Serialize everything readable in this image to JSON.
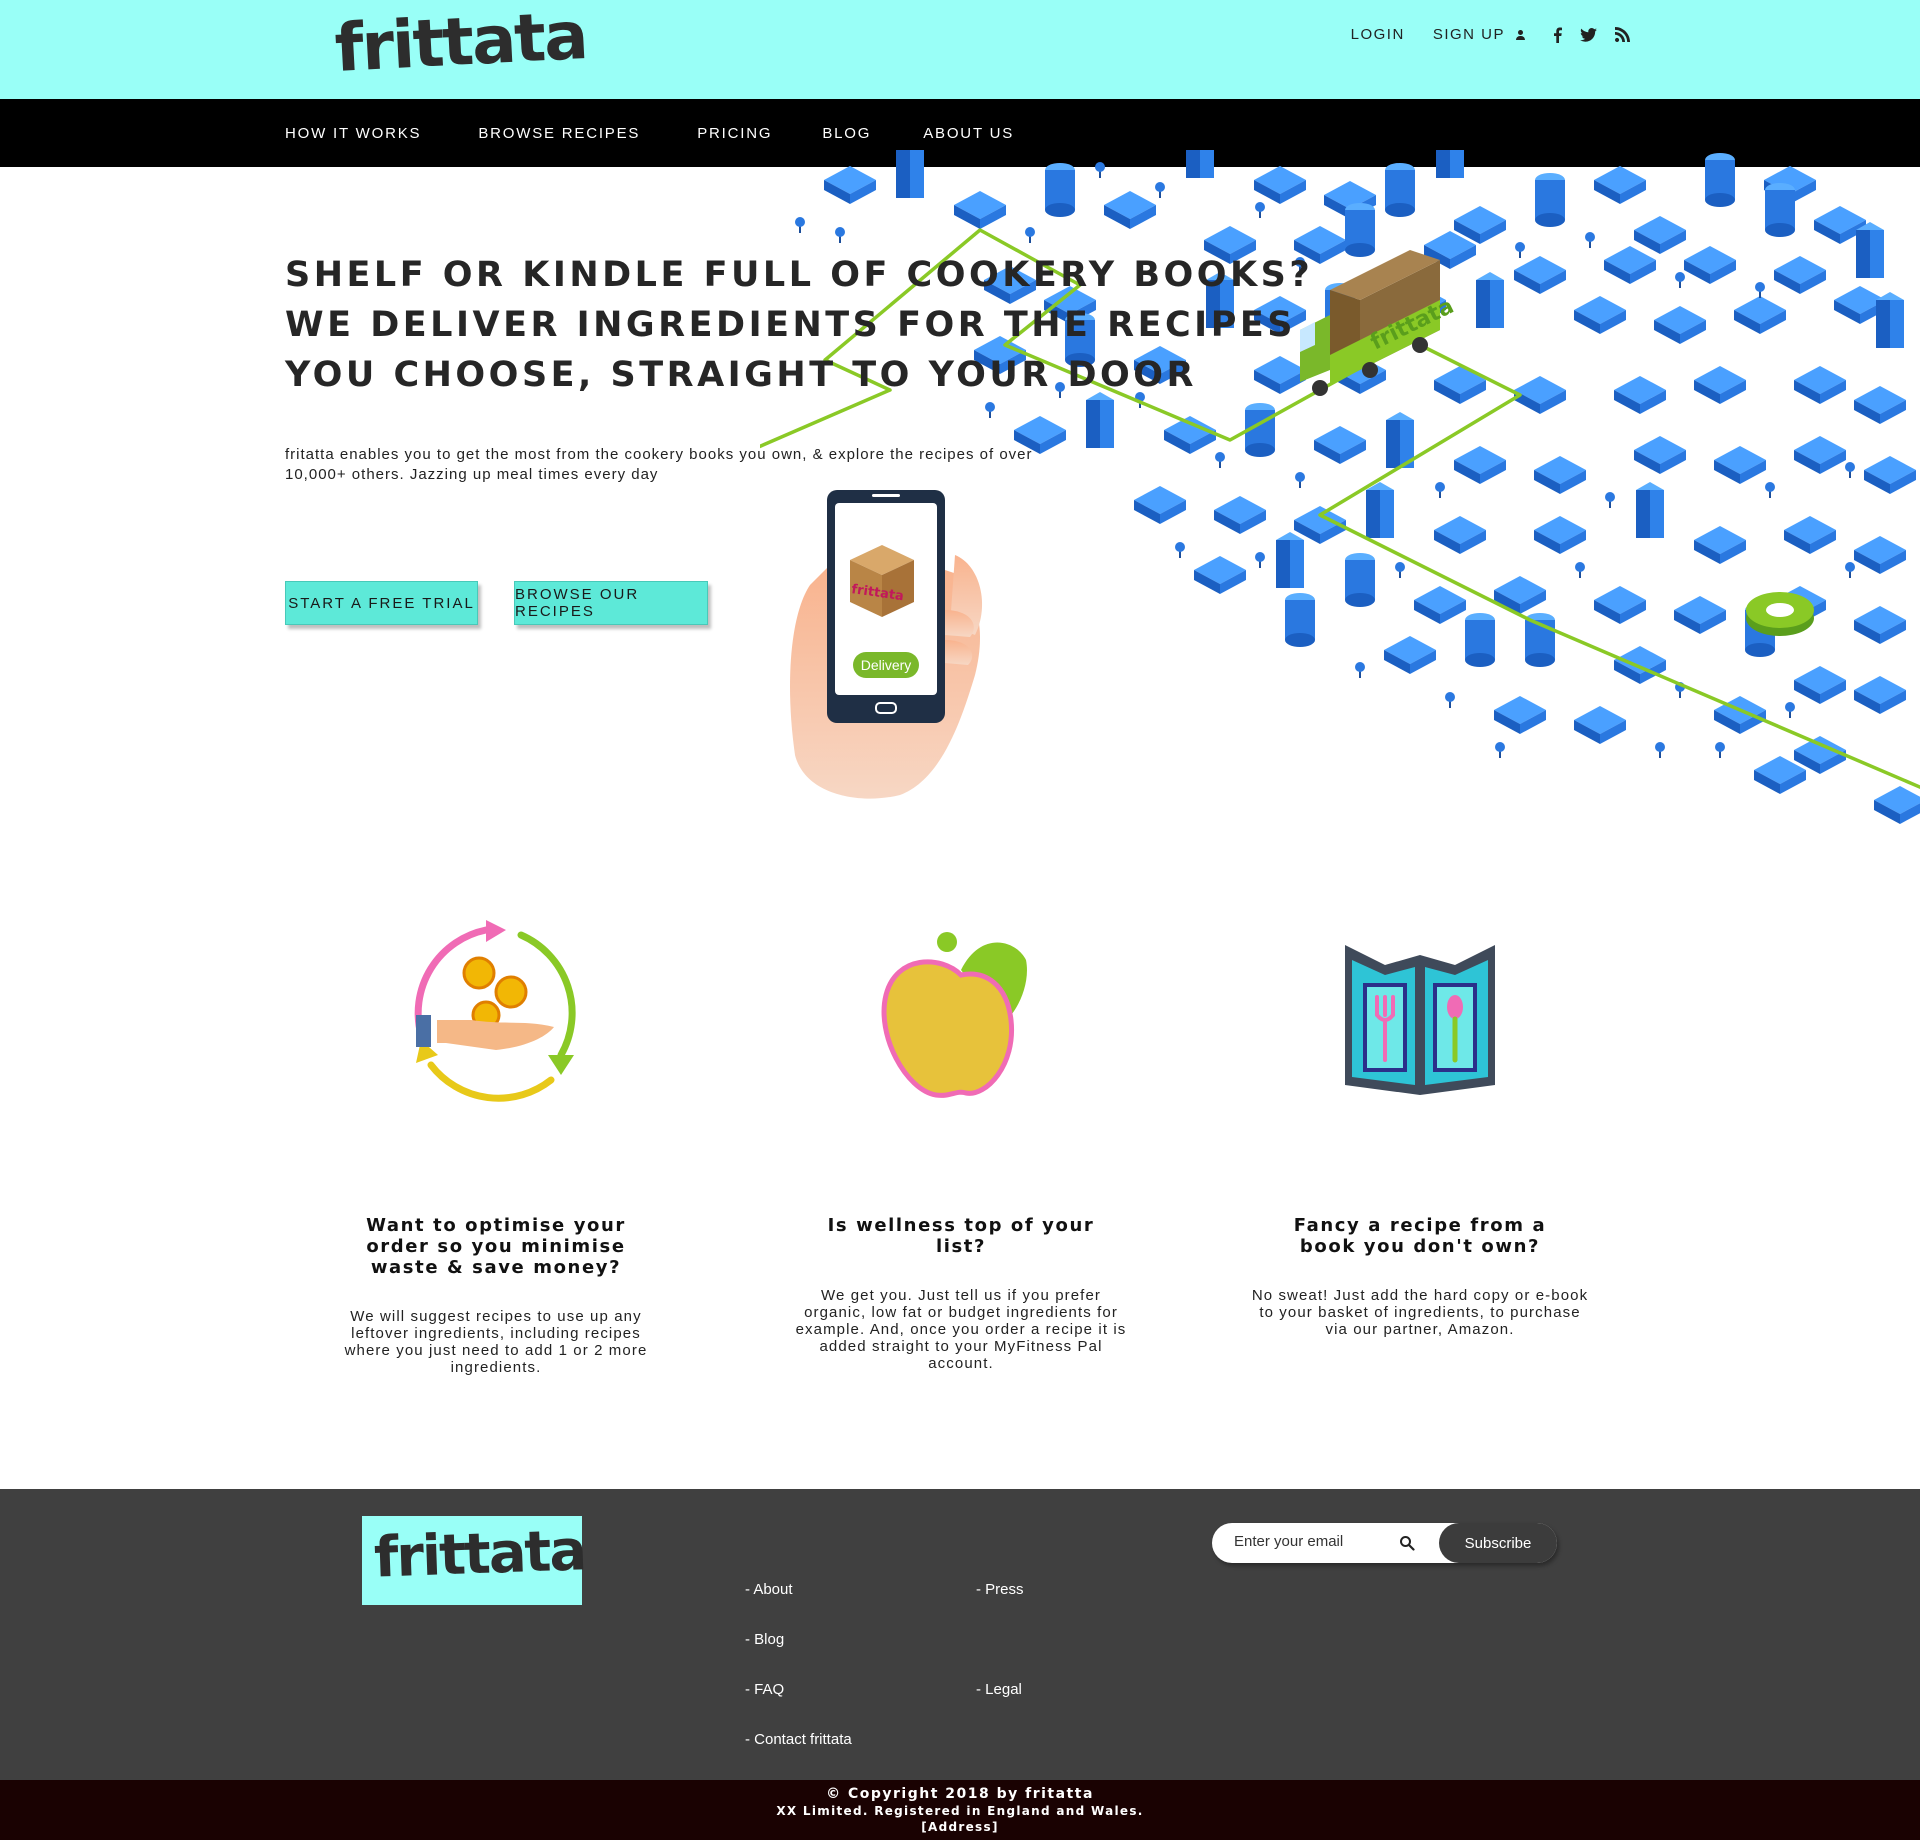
{
  "header": {
    "logo": "frittata",
    "login": "LOGIN",
    "signup": "SIGN UP"
  },
  "nav": {
    "items": [
      "HOW IT WORKS",
      "BROWSE RECIPES",
      "PRICING",
      "BLOG",
      "ABOUT US"
    ]
  },
  "hero": {
    "title_lines": [
      "SHELF OR KINDLE FULL OF COOKERY BOOKS?",
      "WE DELIVER INGREDIENTS FOR THE RECIPES",
      "YOU CHOOSE, STRAIGHT TO YOUR DOOR"
    ],
    "subtitle": "fritatta enables you to get the most from the cookery books you own, & explore the recipes of over 10,000+ others. Jazzing up meal times every day",
    "btn_trial": "START A FREE TRIAL",
    "btn_browse": "BROWSE OUR RECIPES",
    "phone_box_label": "frittata",
    "phone_button": "Delivery",
    "truck_label": "frittata"
  },
  "features": [
    {
      "icon": "money-cycle-icon",
      "title": "Want to optimise your order so you minimise waste & save money?",
      "text": "We will suggest recipes to use up any leftover ingredients, including recipes where you just need to add 1 or 2 more ingredients."
    },
    {
      "icon": "apple-icon",
      "title": "Is wellness top of your list?",
      "text": "We get you. Just tell us if you prefer organic, low fat or budget ingredients for example. And, once you order a recipe it is added straight to your MyFitness Pal account."
    },
    {
      "icon": "recipe-book-icon",
      "title": "Fancy a recipe from a book you don't own?",
      "text": "No sweat! Just add the hard copy or e-book to your basket of ingredients, to purchase via our partner, Amazon."
    }
  ],
  "footer": {
    "logo": "frittata",
    "links": {
      "about": "- About",
      "press": "- Press",
      "blog": "- Blog",
      "faq": "- FAQ",
      "legal": "- Legal",
      "contact": "- Contact frittata"
    },
    "email_placeholder": "Enter your email",
    "subscribe": "Subscribe",
    "copyright": "© Copyright 2018 by fritatta",
    "registered": "XX Limited. Registered in England and Wales.",
    "address": "[Address]"
  },
  "colors": {
    "topbar": "#99fff7",
    "nav": "#000000",
    "button": "#5de9d8",
    "footer": "#404040",
    "copyright_bar": "#1a0202",
    "city_blue": "#2a7fe8",
    "route_green": "#8ac926"
  }
}
